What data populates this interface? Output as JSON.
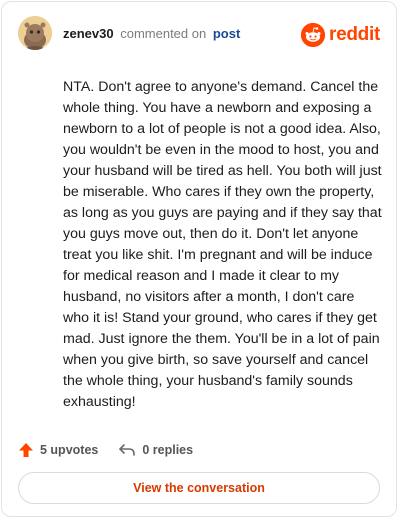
{
  "header": {
    "username": "zenev30",
    "action_text": "commented on",
    "post_link": "post",
    "brand": "reddit"
  },
  "comment": {
    "body": "NTA. Don't agree to anyone's demand. Cancel the whole thing. You have a newborn and exposing a newborn to a lot of people is not a good idea. Also, you wouldn't be even in the mood to host, you and your husband will be tired as hell. You both will just be miserable. Who cares if they own the property, as long as you guys are paying and if they say that you guys move out, then do it. Don't let anyone treat you like shit. I'm pregnant and will be induce for medical reason and I made it clear to my husband, no visitors after a month, I don't care who it is! Stand your ground, who cares if they get mad. Just ignore the them. You'll be in a lot of pain when you give birth, so save yourself and cancel the whole thing, your husband's family sounds exhausting!"
  },
  "actions": {
    "upvotes": "5 upvotes",
    "replies": "0 replies"
  },
  "footer": {
    "view_label": "View the conversation"
  },
  "colors": {
    "brand": "#ff4500",
    "upvote": "#ff4500",
    "link": "#1c4a93",
    "button_text": "#d93a00"
  },
  "icons": {
    "avatar": "reddit-snoo-avatar",
    "brand": "reddit-snoo-logo",
    "upvote": "upvote-arrow-icon",
    "reply": "reply-arrow-icon"
  }
}
